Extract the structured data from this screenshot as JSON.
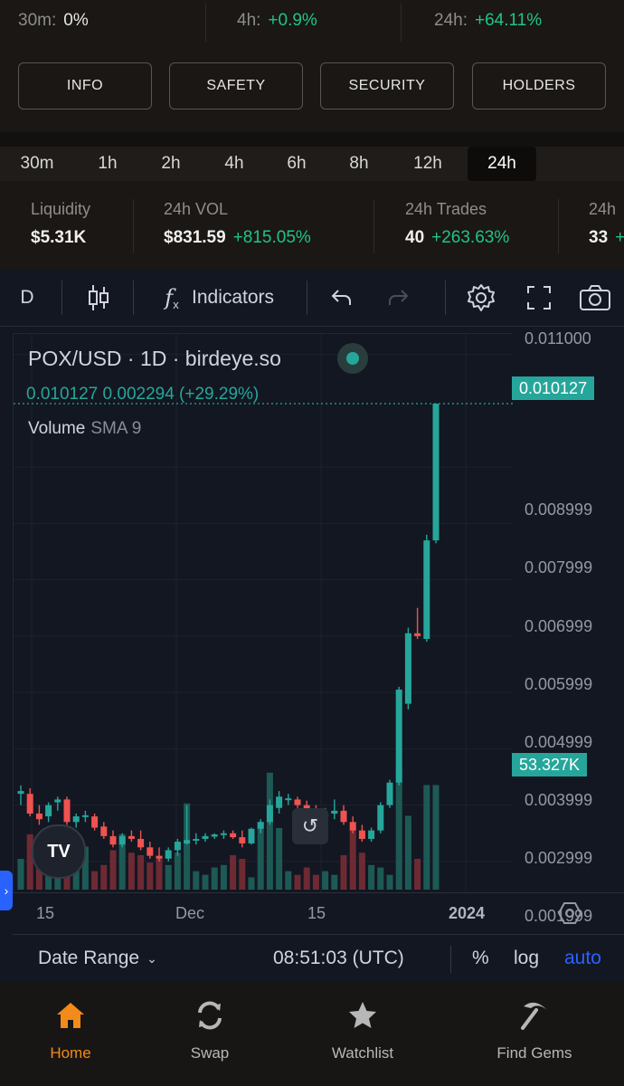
{
  "changes": [
    {
      "label": "30m:",
      "value": "0%",
      "tone": "neutral"
    },
    {
      "label": "4h:",
      "value": "+0.9%",
      "tone": "pos"
    },
    {
      "label": "24h:",
      "value": "+64.11%",
      "tone": "pos"
    }
  ],
  "tabs": [
    "INFO",
    "SAFETY",
    "SECURITY",
    "HOLDERS"
  ],
  "timeframes": [
    "30m",
    "1h",
    "2h",
    "4h",
    "6h",
    "8h",
    "12h",
    "24h"
  ],
  "active_timeframe": "24h",
  "stats": [
    {
      "title": "Liquidity",
      "value": "$5.31K",
      "change": ""
    },
    {
      "title": "24h VOL",
      "value": "$831.59",
      "change": "+815.05%"
    },
    {
      "title": "24h Trades",
      "value": "40",
      "change": "+263.63%"
    },
    {
      "title": "24h",
      "value": "33",
      "change": "+"
    }
  ],
  "toolbar": {
    "interval": "D",
    "indicators_label": "Indicators",
    "icons": [
      "candles-icon",
      "fx-icon",
      "undo-icon",
      "redo-icon",
      "gear-icon",
      "fullscreen-icon",
      "camera-icon"
    ]
  },
  "legend": {
    "title": "POX/USD · 1D · birdeye.so",
    "values": "0.010127  0.002294 (+29.29%)",
    "volume": "Volume",
    "sma": "SMA 9"
  },
  "price_badge": "0.010127",
  "volume_badge": "53.327K",
  "price_ticks": [
    "0.011000",
    "0.008999",
    "0.007999",
    "0.006999",
    "0.005999",
    "0.004999",
    "0.003999",
    "0.002999",
    "0.001999"
  ],
  "time_ticks": [
    "15",
    "Dec",
    "15",
    "2024"
  ],
  "bottom_bar": {
    "date_range": "Date Range",
    "time": "08:51:03 (UTC)",
    "percent": "%",
    "log": "log",
    "auto": "auto"
  },
  "nav": [
    {
      "label": "Home",
      "icon": "home-icon"
    },
    {
      "label": "Swap",
      "icon": "swap-icon"
    },
    {
      "label": "Watchlist",
      "icon": "star-icon"
    },
    {
      "label": "Find Gems",
      "icon": "pickaxe-icon"
    }
  ],
  "colors": {
    "up": "#26a69a",
    "down": "#ef5350",
    "accent": "#f28b1a",
    "link": "#2962ff"
  },
  "chart_data": {
    "type": "candlestick",
    "title": "POX/USD · 1D · birdeye.so",
    "y_range": [
      0.0015,
      0.0113
    ],
    "candles": [
      {
        "o": 0.0032,
        "h": 0.00335,
        "l": 0.003,
        "c": 0.00325
      },
      {
        "o": 0.0032,
        "h": 0.0033,
        "l": 0.0028,
        "c": 0.00285
      },
      {
        "o": 0.00285,
        "h": 0.003,
        "l": 0.00265,
        "c": 0.00275
      },
      {
        "o": 0.0028,
        "h": 0.00305,
        "l": 0.0027,
        "c": 0.003
      },
      {
        "o": 0.00305,
        "h": 0.00315,
        "l": 0.0029,
        "c": 0.0031
      },
      {
        "o": 0.0031,
        "h": 0.00315,
        "l": 0.00265,
        "c": 0.0027
      },
      {
        "o": 0.0027,
        "h": 0.00285,
        "l": 0.0026,
        "c": 0.0028
      },
      {
        "o": 0.0028,
        "h": 0.0029,
        "l": 0.0027,
        "c": 0.00282
      },
      {
        "o": 0.0028,
        "h": 0.00285,
        "l": 0.00255,
        "c": 0.0026
      },
      {
        "o": 0.00262,
        "h": 0.0027,
        "l": 0.0024,
        "c": 0.00245
      },
      {
        "o": 0.00245,
        "h": 0.00255,
        "l": 0.00225,
        "c": 0.0023
      },
      {
        "o": 0.0023,
        "h": 0.0025,
        "l": 0.00225,
        "c": 0.00245
      },
      {
        "o": 0.00245,
        "h": 0.00255,
        "l": 0.00235,
        "c": 0.0024
      },
      {
        "o": 0.0024,
        "h": 0.00255,
        "l": 0.0022,
        "c": 0.00225
      },
      {
        "o": 0.00225,
        "h": 0.00235,
        "l": 0.00205,
        "c": 0.0021
      },
      {
        "o": 0.0021,
        "h": 0.00225,
        "l": 0.002,
        "c": 0.00205
      },
      {
        "o": 0.00205,
        "h": 0.00225,
        "l": 0.002,
        "c": 0.0022
      },
      {
        "o": 0.0022,
        "h": 0.0024,
        "l": 0.0021,
        "c": 0.00235
      },
      {
        "o": 0.00232,
        "h": 0.003,
        "l": 0.0023,
        "c": 0.00238
      },
      {
        "o": 0.00238,
        "h": 0.0025,
        "l": 0.0023,
        "c": 0.0024
      },
      {
        "o": 0.0024,
        "h": 0.0025,
        "l": 0.00235,
        "c": 0.00245
      },
      {
        "o": 0.00244,
        "h": 0.0025,
        "l": 0.0024,
        "c": 0.00248
      },
      {
        "o": 0.00248,
        "h": 0.00255,
        "l": 0.0024,
        "c": 0.0025
      },
      {
        "o": 0.0025,
        "h": 0.00255,
        "l": 0.0024,
        "c": 0.00243
      },
      {
        "o": 0.00243,
        "h": 0.00255,
        "l": 0.00225,
        "c": 0.00232
      },
      {
        "o": 0.00232,
        "h": 0.0026,
        "l": 0.0023,
        "c": 0.00258
      },
      {
        "o": 0.00258,
        "h": 0.00275,
        "l": 0.0025,
        "c": 0.0027
      },
      {
        "o": 0.0027,
        "h": 0.0031,
        "l": 0.00265,
        "c": 0.003
      },
      {
        "o": 0.00295,
        "h": 0.00325,
        "l": 0.00285,
        "c": 0.00315
      },
      {
        "o": 0.0031,
        "h": 0.0032,
        "l": 0.003,
        "c": 0.00312
      },
      {
        "o": 0.0031,
        "h": 0.00315,
        "l": 0.00295,
        "c": 0.003
      },
      {
        "o": 0.003,
        "h": 0.00308,
        "l": 0.00285,
        "c": 0.0029
      },
      {
        "o": 0.0029,
        "h": 0.003,
        "l": 0.00275,
        "c": 0.0028
      },
      {
        "o": 0.0028,
        "h": 0.00295,
        "l": 0.0027,
        "c": 0.00285
      },
      {
        "o": 0.00285,
        "h": 0.0031,
        "l": 0.00275,
        "c": 0.0029
      },
      {
        "o": 0.0029,
        "h": 0.003,
        "l": 0.00265,
        "c": 0.0027
      },
      {
        "o": 0.0027,
        "h": 0.0028,
        "l": 0.0025,
        "c": 0.00255
      },
      {
        "o": 0.00255,
        "h": 0.00265,
        "l": 0.00235,
        "c": 0.0024
      },
      {
        "o": 0.0024,
        "h": 0.0026,
        "l": 0.00235,
        "c": 0.00255
      },
      {
        "o": 0.00255,
        "h": 0.00305,
        "l": 0.0025,
        "c": 0.003
      },
      {
        "o": 0.003,
        "h": 0.00345,
        "l": 0.00295,
        "c": 0.0034
      },
      {
        "o": 0.0034,
        "h": 0.0051,
        "l": 0.00335,
        "c": 0.00505
      },
      {
        "o": 0.0048,
        "h": 0.00615,
        "l": 0.0047,
        "c": 0.00605
      },
      {
        "o": 0.00605,
        "h": 0.0065,
        "l": 0.00595,
        "c": 0.006
      },
      {
        "o": 0.00595,
        "h": 0.0078,
        "l": 0.0059,
        "c": 0.0077
      },
      {
        "o": 0.0077,
        "h": 0.01013,
        "l": 0.00765,
        "c": 0.010127
      }
    ],
    "volume_ratios": [
      0.25,
      0.45,
      0.35,
      0.3,
      0.25,
      0.28,
      0.2,
      0.35,
      0.15,
      0.2,
      0.32,
      0.45,
      0.3,
      0.28,
      0.22,
      0.25,
      0.2,
      0.3,
      0.7,
      0.15,
      0.12,
      0.18,
      0.2,
      0.28,
      0.25,
      0.1,
      0.55,
      0.95,
      0.5,
      0.15,
      0.12,
      0.18,
      0.12,
      0.15,
      0.12,
      0.28,
      0.5,
      0.3,
      0.2,
      0.18,
      0.12,
      1.0,
      0.6,
      0.25,
      0.85,
      0.85
    ]
  }
}
